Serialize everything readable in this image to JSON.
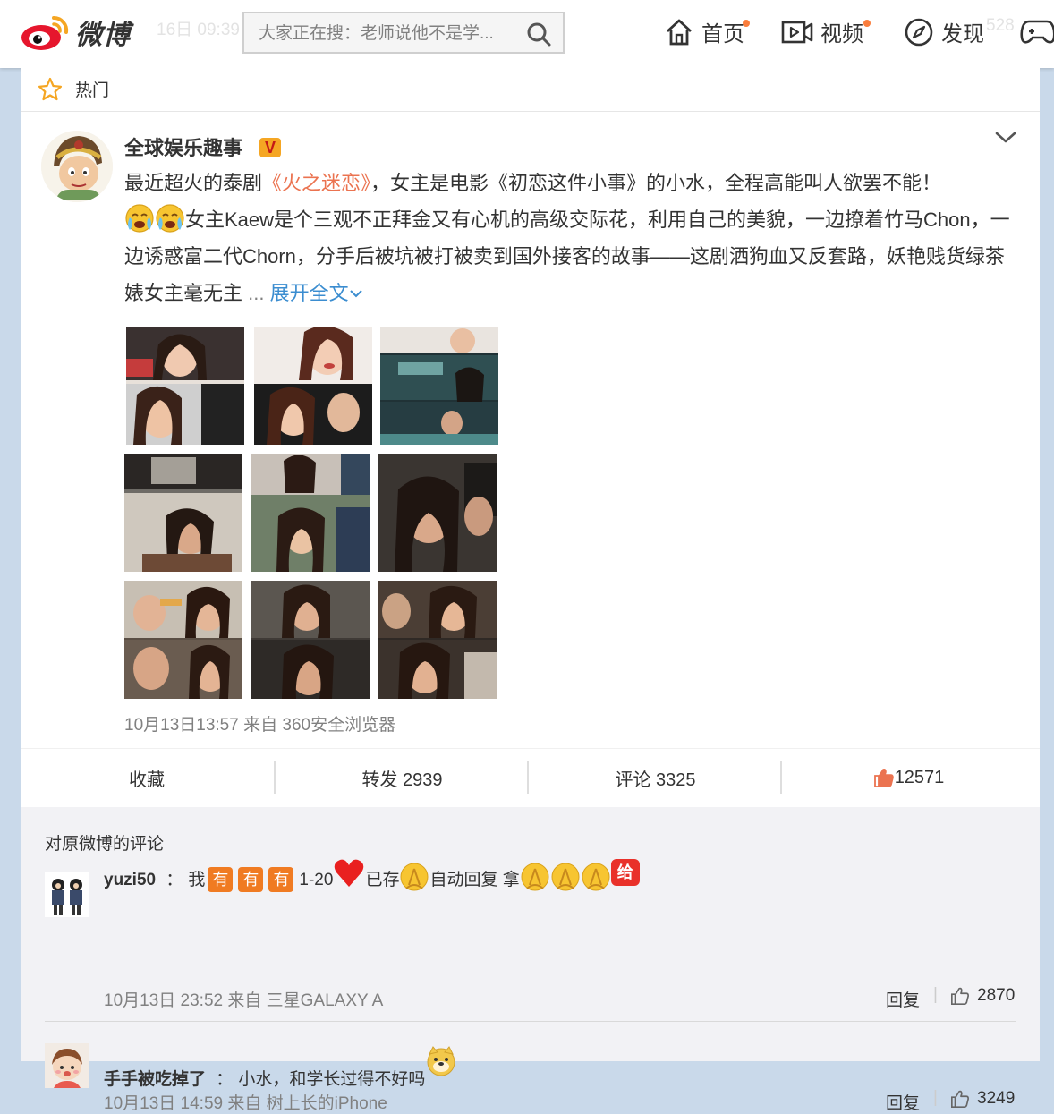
{
  "app": {
    "logo_text": "微博"
  },
  "search": {
    "placeholder": "大家正在搜：老师说他不是学..."
  },
  "nav": {
    "home": "首页",
    "video": "视频",
    "discover": "发现"
  },
  "background_ghost": {
    "time": "16日 09:39",
    "count": "528"
  },
  "feed": {
    "tab_label": "热门"
  },
  "post": {
    "author": "全球娱乐趣事",
    "verified_mark": "V",
    "text_1": "最近超火的泰剧",
    "link_title": "《火之迷恋》",
    "text_2": "，女主是电影《初恋这件小事》的小水，全程高能叫人欲罢不能！",
    "text_3": "女主Kaew是个三观不正拜金又有心机的高级交际花，利用自己的美貌，一边撩着竹马Chon，一边诱惑富二代Chorn，分手后被坑被打被卖到国外接客的故事——这剧洒狗血又反套路，妖艳贱货绿茶婊女主毫无主",
    "ellipsis": "...",
    "expand": "展开全文",
    "meta": "10月13日13:57 来自 360安全浏览器"
  },
  "actions": {
    "favorite": "收藏",
    "repost": "转发 2939",
    "comment": "评论 3325",
    "like": "12571"
  },
  "comments": {
    "title": "对原微博的评论",
    "items": [
      {
        "user": "yuzi50",
        "sep": "：",
        "t1": "我",
        "badge": "有",
        "t2": "1-20",
        "t3": "已存",
        "t4": "自动回复 拿",
        "gift": "给",
        "meta": "10月13日 23:52 来自 三星GALAXY A",
        "reply": "回复",
        "likes": "2870"
      },
      {
        "user": "手手被吃掉了",
        "sep": "：",
        "t1": "小水，和学长过得不好吗",
        "meta": "10月13日 14:59 来自 树上长的iPhone",
        "reply": "回复",
        "likes": "3249"
      }
    ]
  }
}
